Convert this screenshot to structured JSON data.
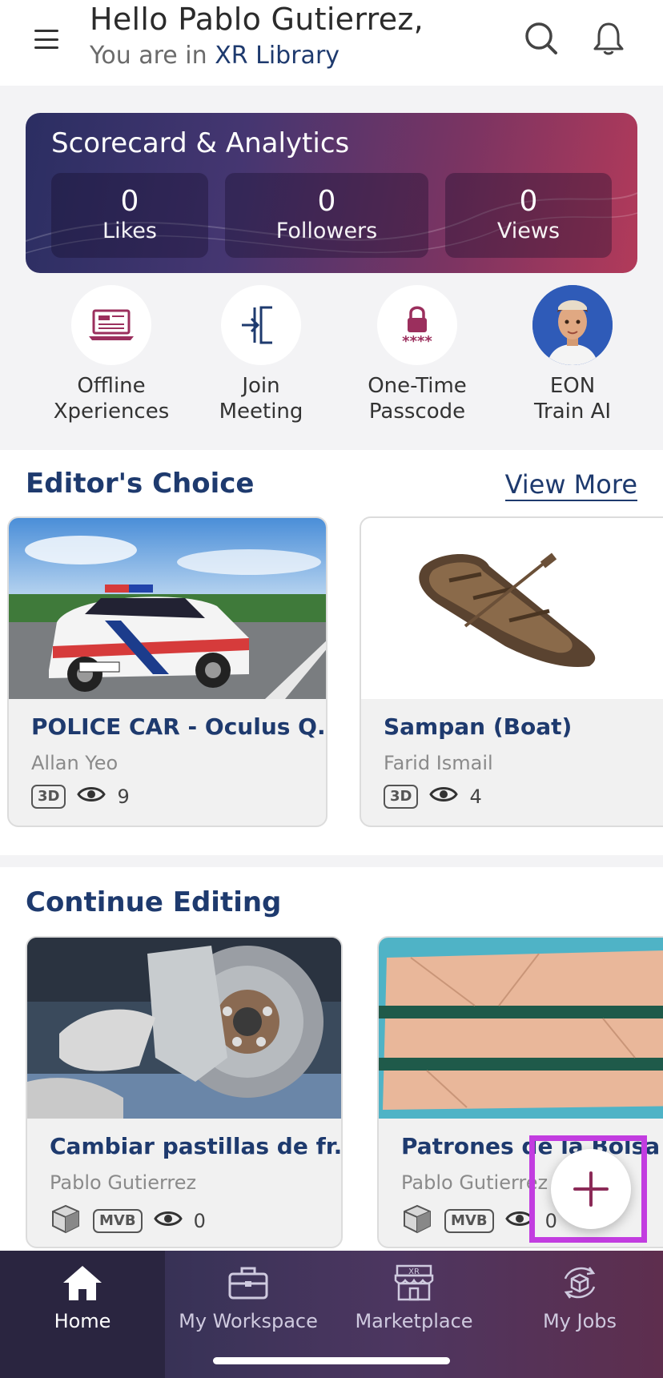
{
  "header": {
    "greeting": "Hello Pablo Gutierrez,",
    "location_prefix": "You are in",
    "location_name": "XR Library",
    "icons": [
      "menu-icon",
      "search-icon",
      "bell-icon"
    ]
  },
  "scorecard": {
    "title": "Scorecard & Analytics",
    "stats": [
      {
        "value": "0",
        "label": "Likes"
      },
      {
        "value": "0",
        "label": "Followers"
      },
      {
        "value": "0",
        "label": "Views"
      }
    ]
  },
  "quick_actions": [
    {
      "label": "Offline\nXperiences",
      "icon": "laptop-icon"
    },
    {
      "label": "Join\nMeeting",
      "icon": "join-meeting-icon"
    },
    {
      "label": "One-Time\nPasscode",
      "icon": "lock-passcode-icon"
    },
    {
      "label": "EON\nTrain AI",
      "icon": "avatar-icon"
    }
  ],
  "editors_choice": {
    "title": "Editor's Choice",
    "view_more": "View More",
    "items": [
      {
        "title": "POLICE CAR - Oculus Q...",
        "author": "Allan Yeo",
        "badge": "3D",
        "views": "9"
      },
      {
        "title": "Sampan (Boat)",
        "author": "Farid Ismail",
        "badge": "3D",
        "views": "4"
      }
    ]
  },
  "continue_editing": {
    "title": "Continue Editing",
    "items": [
      {
        "title": "Cambiar pastillas de fr...",
        "author": "Pablo Gutierrez",
        "badge": "MVB",
        "views": "0"
      },
      {
        "title": "Patrones de la Bolsa",
        "author": "Pablo Gutierrez",
        "badge": "MVB",
        "views": "0"
      }
    ]
  },
  "nav": [
    {
      "label": "Home",
      "icon": "home-icon",
      "active": true
    },
    {
      "label": "My Workspace",
      "icon": "briefcase-icon",
      "active": false
    },
    {
      "label": "Marketplace",
      "icon": "store-icon",
      "active": false
    },
    {
      "label": "My Jobs",
      "icon": "jobs-icon",
      "active": false
    }
  ],
  "colors": {
    "primary": "#1e3a6e",
    "accent": "#9b2f5d",
    "fab_highlight": "#c23de0"
  }
}
